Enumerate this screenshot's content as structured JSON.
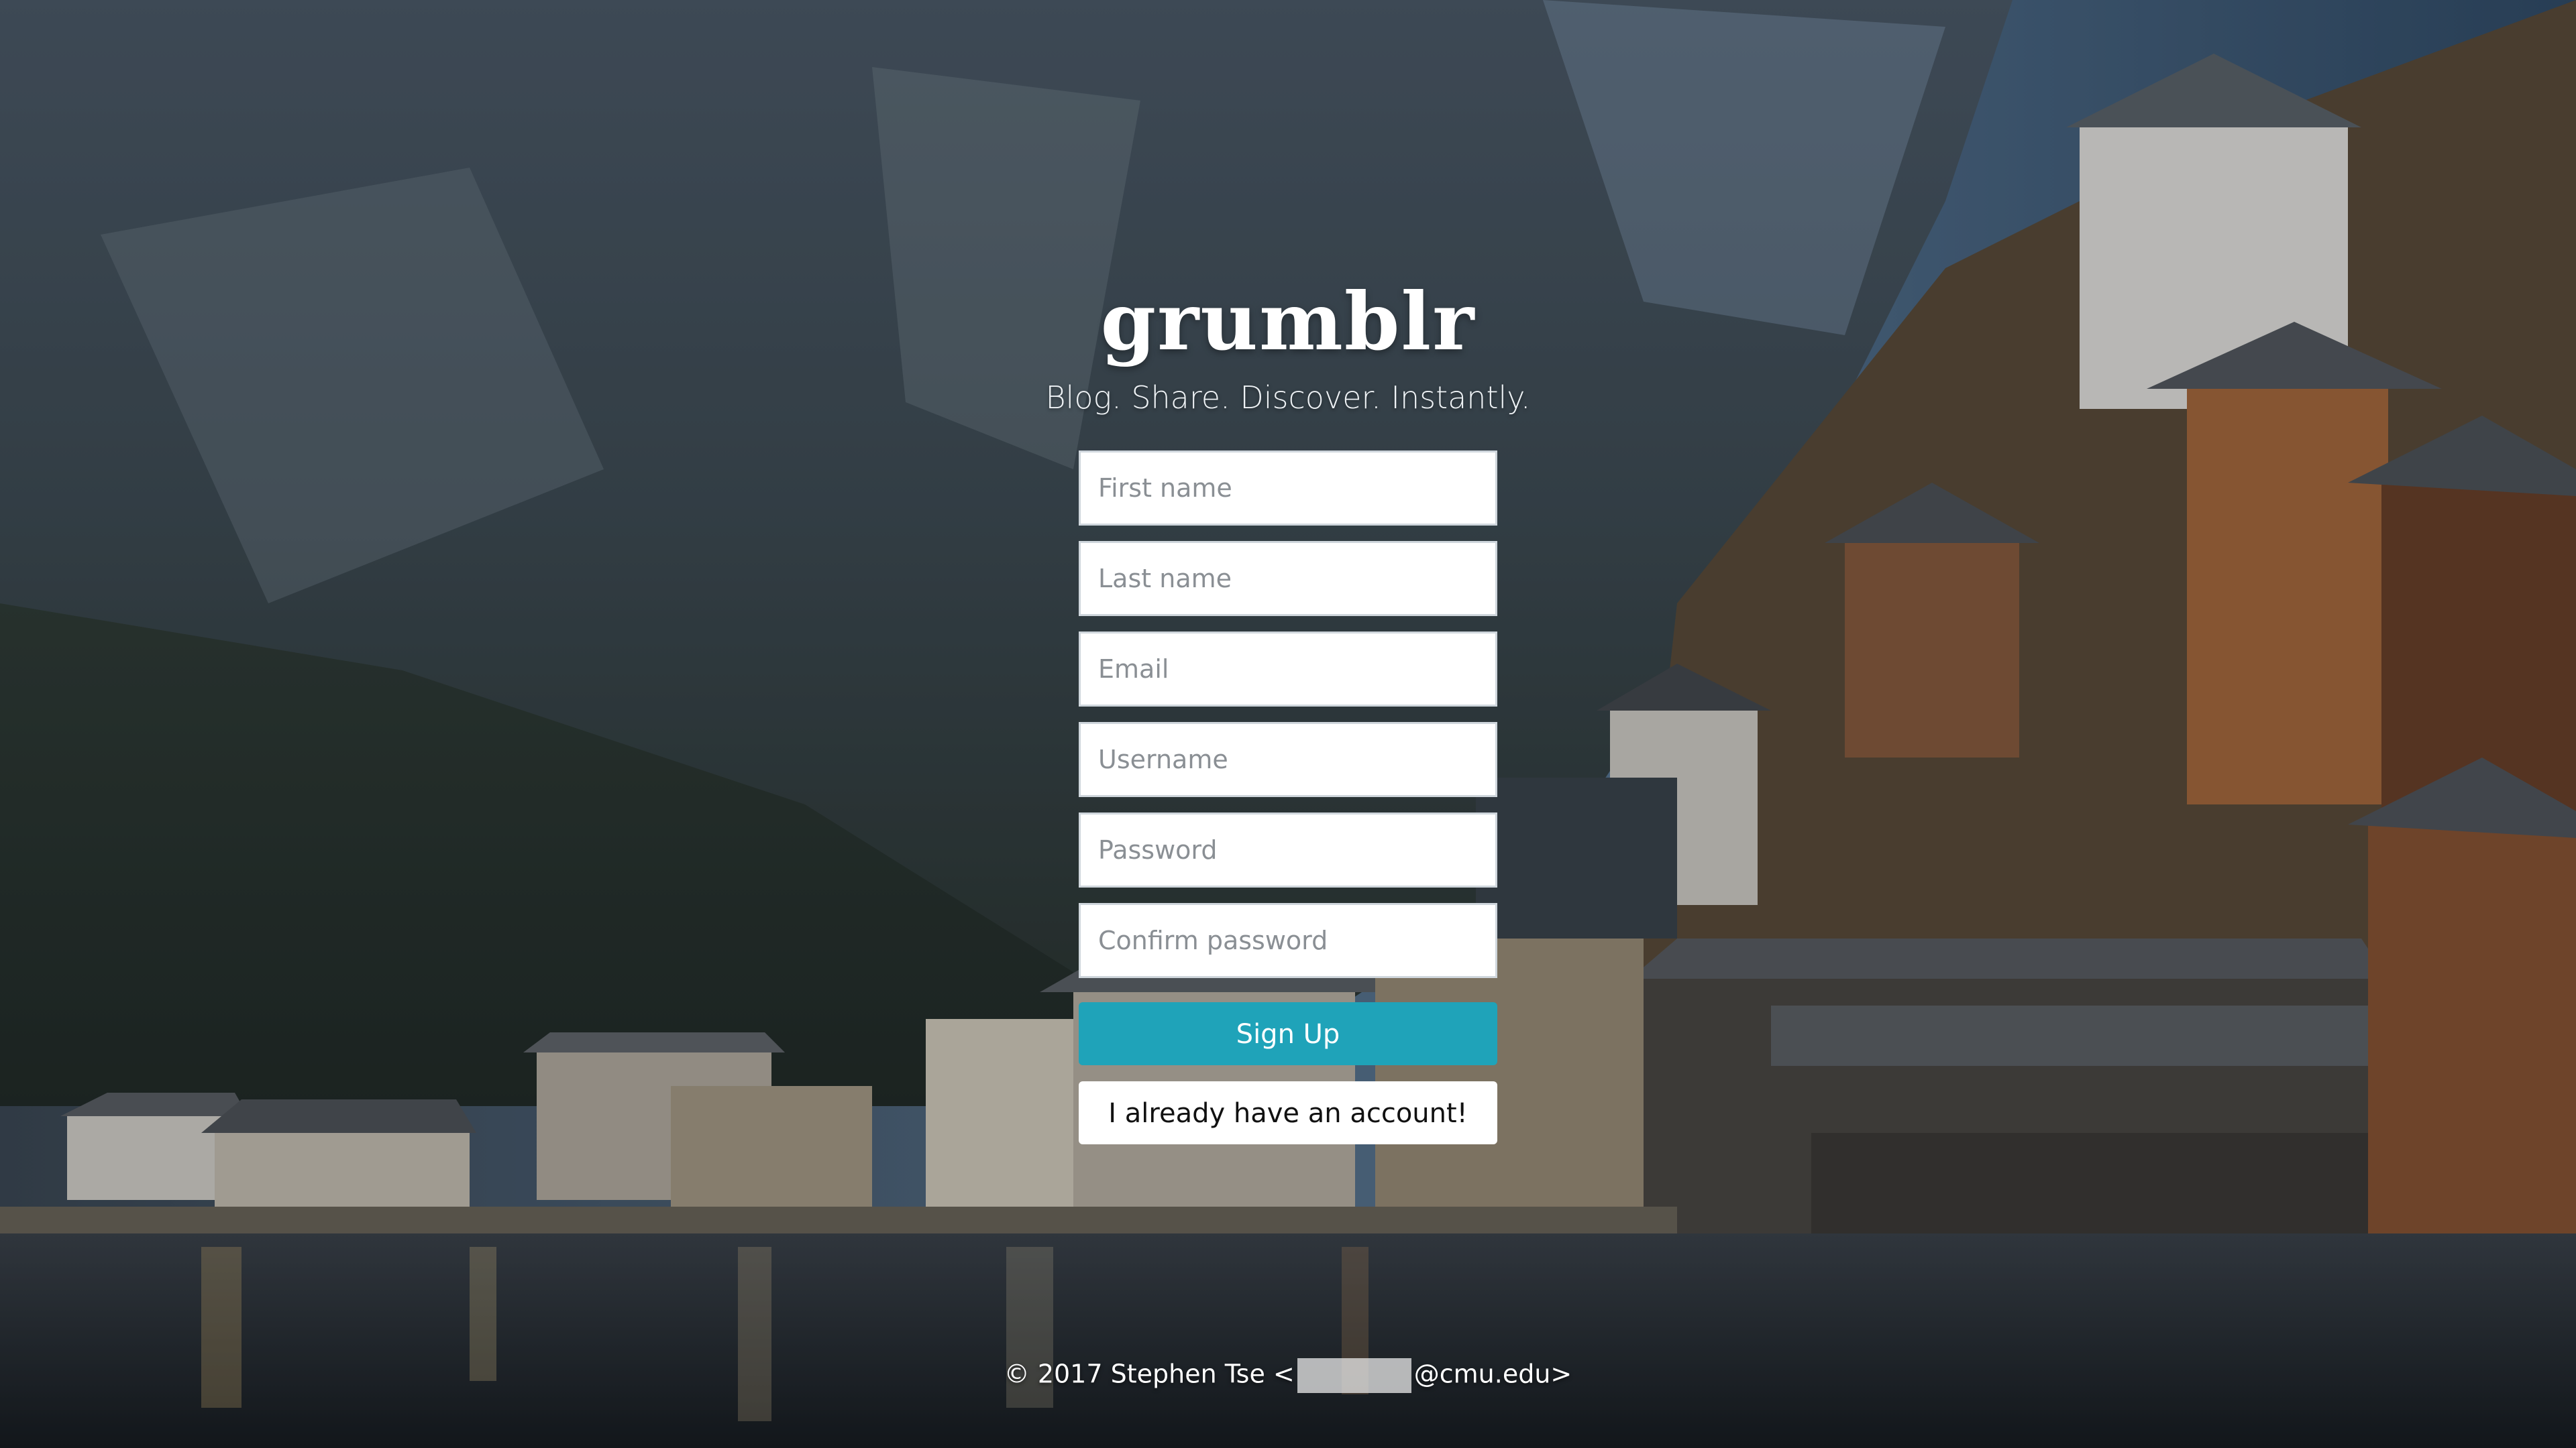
{
  "app": {
    "logo": "grumblr",
    "tagline": "Blog. Share. Discover. Instantly."
  },
  "signup_form": {
    "first_name_placeholder": "First name",
    "last_name_placeholder": "Last name",
    "email_placeholder": "Email",
    "username_placeholder": "Username",
    "password_placeholder": "Password",
    "confirm_password_placeholder": "Confirm password",
    "submit_label": "Sign Up",
    "login_label": "I already have an account!"
  },
  "footer": {
    "copyright_prefix": "© 2017 Stephen Tse <",
    "email_domain": "@cmu.edu>"
  },
  "colors": {
    "primary_button": "#1fa3b9",
    "input_background": "#ffffff",
    "text_on_dark": "#ffffff"
  },
  "background": {
    "icon": "lakeside-village-photo"
  }
}
